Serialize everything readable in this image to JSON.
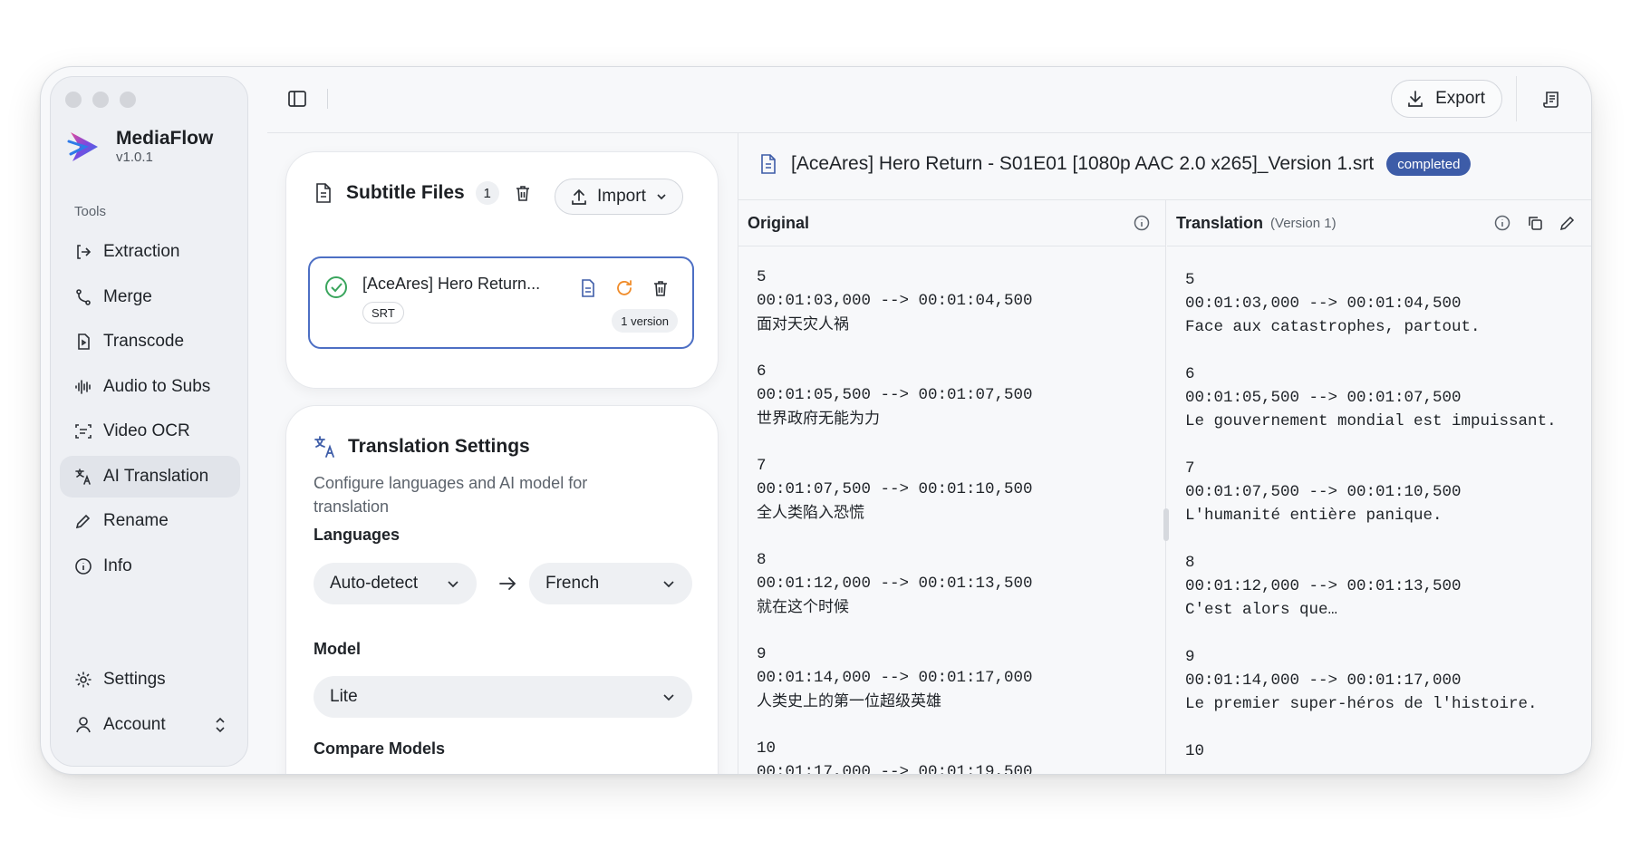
{
  "app": {
    "name": "MediaFlow",
    "version": "v1.0.1"
  },
  "sidebar": {
    "section_label": "Tools",
    "items": [
      {
        "label": "Extraction",
        "icon": "extraction-icon"
      },
      {
        "label": "Merge",
        "icon": "merge-icon"
      },
      {
        "label": "Transcode",
        "icon": "transcode-icon"
      },
      {
        "label": "Audio to Subs",
        "icon": "audio-wave-icon"
      },
      {
        "label": "Video OCR",
        "icon": "ocr-icon"
      },
      {
        "label": "AI Translation",
        "icon": "translate-icon",
        "active": true
      },
      {
        "label": "Rename",
        "icon": "pen-icon"
      },
      {
        "label": "Info",
        "icon": "info-icon"
      }
    ],
    "bottom": [
      {
        "label": "Settings",
        "icon": "gear-icon"
      },
      {
        "label": "Account",
        "icon": "user-icon"
      }
    ]
  },
  "topbar": {
    "export_label": "Export"
  },
  "files": {
    "title": "Subtitle Files",
    "count": "1",
    "import_label": "Import",
    "items": [
      {
        "name": "[AceAres] Hero Return...",
        "format": "SRT",
        "versions": "1 version"
      }
    ]
  },
  "settings": {
    "title": "Translation Settings",
    "description": "Configure languages and AI model for translation",
    "languages_label": "Languages",
    "source_language": "Auto-detect",
    "target_language": "French",
    "model_label": "Model",
    "model_value": "Lite",
    "compare_label": "Compare Models"
  },
  "viewer": {
    "file_title": "[AceAres] Hero Return - S01E01 [1080p AAC 2.0 x265]_Version 1.srt",
    "status": "completed",
    "original_label": "Original",
    "translation_label": "Translation",
    "translation_version": "(Version 1)",
    "original": [
      {
        "index": "5",
        "time": "00:01:03,000 --> 00:01:04,500",
        "text": "面对天灾人祸"
      },
      {
        "index": "6",
        "time": "00:01:05,500 --> 00:01:07,500",
        "text": "世界政府无能为力"
      },
      {
        "index": "7",
        "time": "00:01:07,500 --> 00:01:10,500",
        "text": "全人类陷入恐慌"
      },
      {
        "index": "8",
        "time": "00:01:12,000 --> 00:01:13,500",
        "text": "就在这个时候"
      },
      {
        "index": "9",
        "time": "00:01:14,000 --> 00:01:17,000",
        "text": "人类史上的第一位超级英雄"
      },
      {
        "index": "10",
        "time": "00:01:17,000 --> 00:01:19,500",
        "text": ""
      }
    ],
    "translation": [
      {
        "index": "5",
        "time": "00:01:03,000 --> 00:01:04,500",
        "text": "Face aux catastrophes, partout."
      },
      {
        "index": "6",
        "time": "00:01:05,500 --> 00:01:07,500",
        "text": "Le gouvernement mondial est impuissant."
      },
      {
        "index": "7",
        "time": "00:01:07,500 --> 00:01:10,500",
        "text": "L'humanité entière panique."
      },
      {
        "index": "8",
        "time": "00:01:12,000 --> 00:01:13,500",
        "text": "C'est alors que…"
      },
      {
        "index": "9",
        "time": "00:01:14,000 --> 00:01:17,000",
        "text": "Le premier super-héros de l'histoire."
      },
      {
        "index": "10",
        "time": "",
        "text": ""
      }
    ]
  },
  "colors": {
    "accent": "#4d6fc4",
    "status": "#3d5ca8",
    "success": "#3aa55d",
    "warning": "#f08c2a"
  }
}
